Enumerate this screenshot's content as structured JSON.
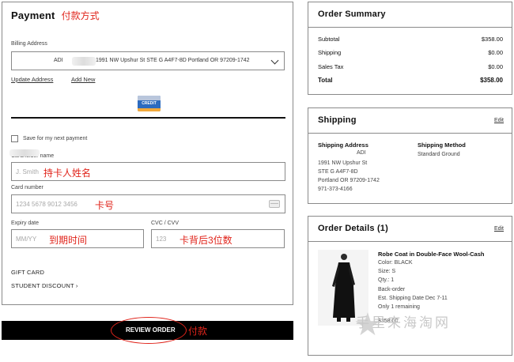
{
  "payment": {
    "title": "Payment",
    "title_annotation": "付款方式",
    "billing_label": "Billing Address",
    "billing_name": "ADI",
    "billing_address": "1991 NW Upshur St STE G A4F7-8D Portland OR 97209-1742",
    "update_address_label": "Update Address",
    "add_new_label": "Add New",
    "card_tab_label": "CREDIT",
    "save_label": "Save for my next payment",
    "cardholder_label": "Cardholder name",
    "cardholder_placeholder": "J. Smith",
    "cardholder_annotation": "持卡人姓名",
    "card_number_label": "Card number",
    "card_number_placeholder": "1234 5678 9012 3456",
    "card_number_annotation": "卡号",
    "expiry_label": "Expiry date",
    "expiry_placeholder": "MM/YY",
    "expiry_annotation": "到期时间",
    "cvc_label": "CVC / CVV",
    "cvc_placeholder": "123",
    "cvc_annotation": "卡背后3位数",
    "gift_card_label": "GIFT CARD",
    "student_discount_label": "STUDENT DISCOUNT"
  },
  "review": {
    "label": "REVIEW ORDER",
    "annotation": "付款"
  },
  "summary": {
    "title": "Order Summary",
    "rows": [
      {
        "label": "Subtotal",
        "value": "$358.00"
      },
      {
        "label": "Shipping",
        "value": "$0.00"
      },
      {
        "label": "Sales Tax",
        "value": "$0.00"
      }
    ],
    "total_label": "Total",
    "total_value": "$358.00"
  },
  "shipping": {
    "title": "Shipping",
    "edit_label": "Edit",
    "address_heading": "Shipping Address",
    "name": "ADI",
    "lines": [
      "1991 NW Upshur St",
      "STE G A4F7-8D",
      "Portland OR 97209-1742",
      "971-373-4166"
    ],
    "method_heading": "Shipping Method",
    "method": "Standard Ground"
  },
  "details": {
    "title": "Order Details (1)",
    "edit_label": "Edit",
    "product_name": "Robe Coat in Double-Face Wool-Cash",
    "color": "Color: BLACK",
    "size": "Size: S",
    "qty": "Qty.: 1",
    "backorder": "Back-order",
    "ship_date": "Est. Shipping Date Dec 7-11",
    "remaining": "Only 1 remaining",
    "price": "$358.00"
  },
  "watermark": "手里来海淘网",
  "colors": {
    "annotation_red": "#e0241b",
    "button_black": "#000000",
    "border_gray": "#8a8a8a"
  }
}
